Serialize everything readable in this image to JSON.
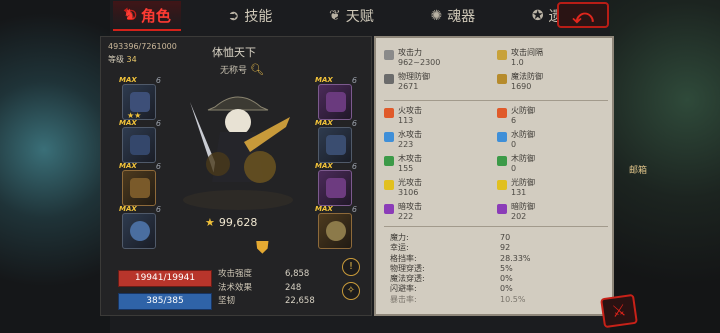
{
  "tabs": [
    {
      "label": "角色",
      "icon": "warrior-helmet-icon",
      "active": true
    },
    {
      "label": "技能",
      "icon": "swirl-icon",
      "active": false
    },
    {
      "label": "天赋",
      "icon": "wings-icon",
      "active": false
    },
    {
      "label": "魂器",
      "icon": "soul-swirl-icon",
      "active": false
    },
    {
      "label": "遗物",
      "icon": "relic-icon",
      "active": false
    }
  ],
  "character": {
    "exp": "493396/7261000",
    "level_label": "等级",
    "level_value": "34",
    "name": "体恤天下",
    "title": "无称号",
    "power": "99,628",
    "hp": "19941/19941",
    "mp": "385/385"
  },
  "mini_stats": [
    {
      "label": "攻击强度",
      "value": "6,858"
    },
    {
      "label": "法术效果",
      "value": "248"
    },
    {
      "label": "坚韧",
      "value": "22,658"
    }
  ],
  "equipment": {
    "max_label": "MAX",
    "upgrade_level": "6"
  },
  "combat_stats": [
    [
      {
        "label": "攻击力",
        "value": "962~2300",
        "icon": "sword-icon"
      },
      {
        "label": "攻击间隔",
        "value": "1.0",
        "icon": "sword-icon"
      }
    ],
    [
      {
        "label": "物理防御",
        "value": "2671",
        "icon": "shield-icon"
      },
      {
        "label": "魔法防御",
        "value": "1690",
        "icon": "shield-icon"
      }
    ]
  ],
  "element_stats": [
    [
      {
        "label": "火攻击",
        "value": "113",
        "icon": "fire-sword-icon"
      },
      {
        "label": "火防御",
        "value": "6",
        "icon": "fire-shield-icon"
      }
    ],
    [
      {
        "label": "水攻击",
        "value": "223",
        "icon": "water-sword-icon"
      },
      {
        "label": "水防御",
        "value": "0",
        "icon": "water-shield-icon"
      }
    ],
    [
      {
        "label": "木攻击",
        "value": "155",
        "icon": "wood-sword-icon"
      },
      {
        "label": "木防御",
        "value": "0",
        "icon": "wood-shield-icon"
      }
    ],
    [
      {
        "label": "光攻击",
        "value": "3106",
        "icon": "light-sword-icon"
      },
      {
        "label": "光防御",
        "value": "131",
        "icon": "light-shield-icon"
      }
    ],
    [
      {
        "label": "暗攻击",
        "value": "222",
        "icon": "dark-sword-icon"
      },
      {
        "label": "暗防御",
        "value": "202",
        "icon": "dark-shield-icon"
      }
    ]
  ],
  "attributes": [
    {
      "label": "魔力:",
      "value": "70"
    },
    {
      "label": "幸运:",
      "value": "92"
    },
    {
      "label": "格挡率:",
      "value": "28.33%"
    },
    {
      "label": "物理穿透:",
      "value": "5%"
    },
    {
      "label": "魔法穿透:",
      "value": "0%"
    },
    {
      "label": "闪避率:",
      "value": "0%"
    },
    {
      "label": "暴击率:",
      "value": "10.5%"
    }
  ],
  "mailbox_label": "邮箱",
  "colors": {
    "active_tab": "#ff3b33",
    "hp_bar": "#b8352b",
    "mp_bar": "#2f63a8",
    "panel_parchment": "#d2ccc0",
    "fire": "#e05a2a",
    "water": "#3f8fd8",
    "wood": "#3c9a48",
    "light": "#e1c01f",
    "dark": "#8b3cb8"
  }
}
